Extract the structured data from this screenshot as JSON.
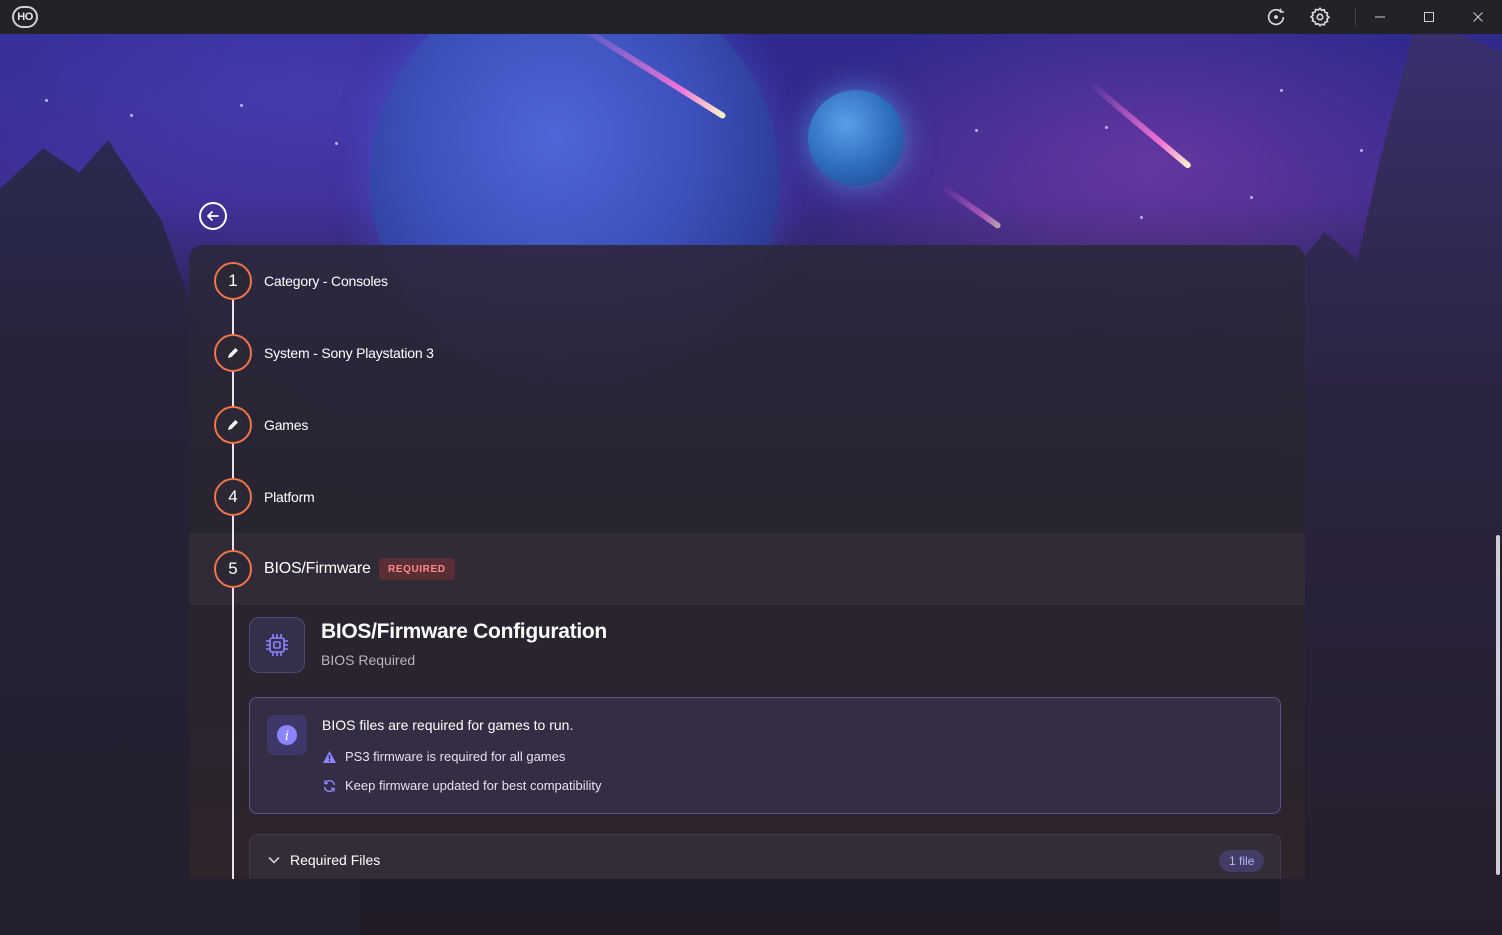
{
  "titlebar": {
    "logo_text": "HO",
    "icons": [
      "refresh-icon",
      "gear-icon",
      "minimize-icon",
      "maximize-icon",
      "close-icon"
    ]
  },
  "steps": [
    {
      "marker": "1",
      "marker_type": "number",
      "label": "Category - Consoles"
    },
    {
      "marker": "",
      "marker_type": "pencil-icon",
      "label": "System - Sony Playstation 3"
    },
    {
      "marker": "",
      "marker_type": "pencil-icon",
      "label": "Games"
    },
    {
      "marker": "4",
      "marker_type": "number",
      "label": "Platform"
    },
    {
      "marker": "5",
      "marker_type": "number",
      "label": "BIOS/Firmware",
      "badge": "REQUIRED"
    }
  ],
  "config": {
    "title": "BIOS/Firmware Configuration",
    "subtitle": "BIOS Required",
    "info": {
      "title": "BIOS files are required for games to run.",
      "lines": [
        {
          "icon": "warning-icon",
          "text": "PS3 firmware is required for all games"
        },
        {
          "icon": "sync-icon",
          "text": "Keep firmware updated for best compatibility"
        }
      ]
    },
    "files": {
      "title": "Required Files",
      "count": "1 file"
    }
  },
  "colors": {
    "accent_orange": "#f07548",
    "required_red": "#ff8a8a",
    "info_purple": "#8b84ff"
  }
}
